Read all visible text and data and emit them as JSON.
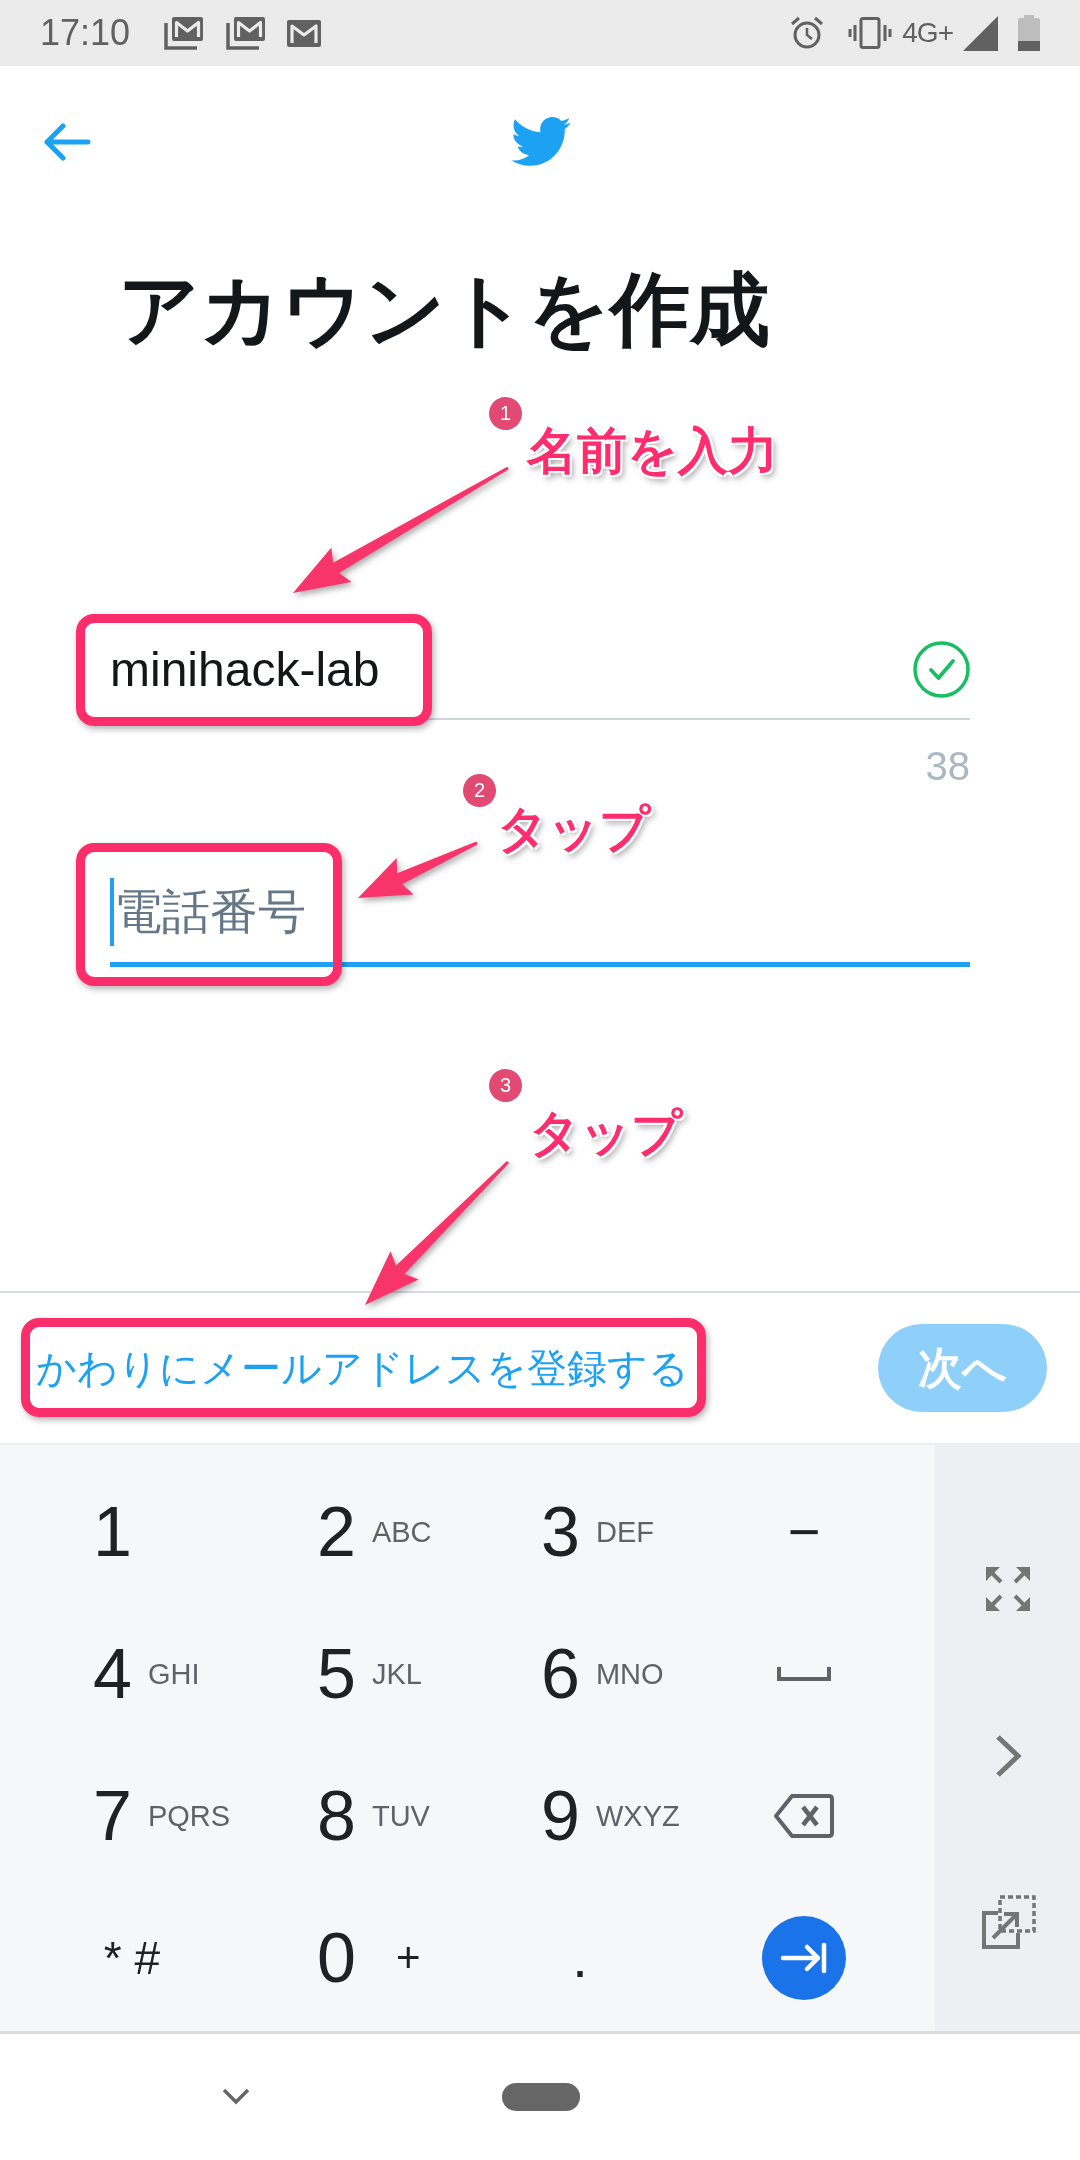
{
  "status_bar": {
    "time": "17:10",
    "network": "4G+"
  },
  "title": "アカウントを作成",
  "form": {
    "fields": [
      {
        "value": "minihack-lab",
        "valid": true,
        "focused": false,
        "counter": "38"
      },
      {
        "placeholder": "電話番号",
        "valid": false,
        "focused": true
      }
    ]
  },
  "footer": {
    "link": "かわりにメールアドレスを登録する",
    "next_button": {
      "label": "次へ",
      "disabled": true
    }
  },
  "keyboard": {
    "keys": [
      {
        "kind": "digit",
        "label": "1"
      },
      {
        "kind": "digit",
        "label": "2",
        "letters": "ABC"
      },
      {
        "kind": "digit",
        "label": "3",
        "letters": "DEF"
      },
      {
        "kind": "symbol",
        "label": "−"
      },
      {
        "kind": "digit",
        "label": "4",
        "letters": "GHI"
      },
      {
        "kind": "digit",
        "label": "5",
        "letters": "JKL"
      },
      {
        "kind": "digit",
        "label": "6",
        "letters": "MNO"
      },
      {
        "kind": "space"
      },
      {
        "kind": "digit",
        "label": "7",
        "letters": "PQRS"
      },
      {
        "kind": "digit",
        "label": "8",
        "letters": "TUV"
      },
      {
        "kind": "digit",
        "label": "9",
        "letters": "WXYZ"
      },
      {
        "kind": "backspace"
      },
      {
        "kind": "symbol",
        "label": "* #"
      },
      {
        "kind": "digit",
        "label": "0",
        "extra": "+"
      },
      {
        "kind": "symbol",
        "label": "."
      },
      {
        "kind": "enter"
      }
    ]
  },
  "annotations": [
    {
      "number": "1",
      "text": "名前を入力"
    },
    {
      "number": "2",
      "text": "タップ"
    },
    {
      "number": "3",
      "text": "タップ"
    }
  ]
}
